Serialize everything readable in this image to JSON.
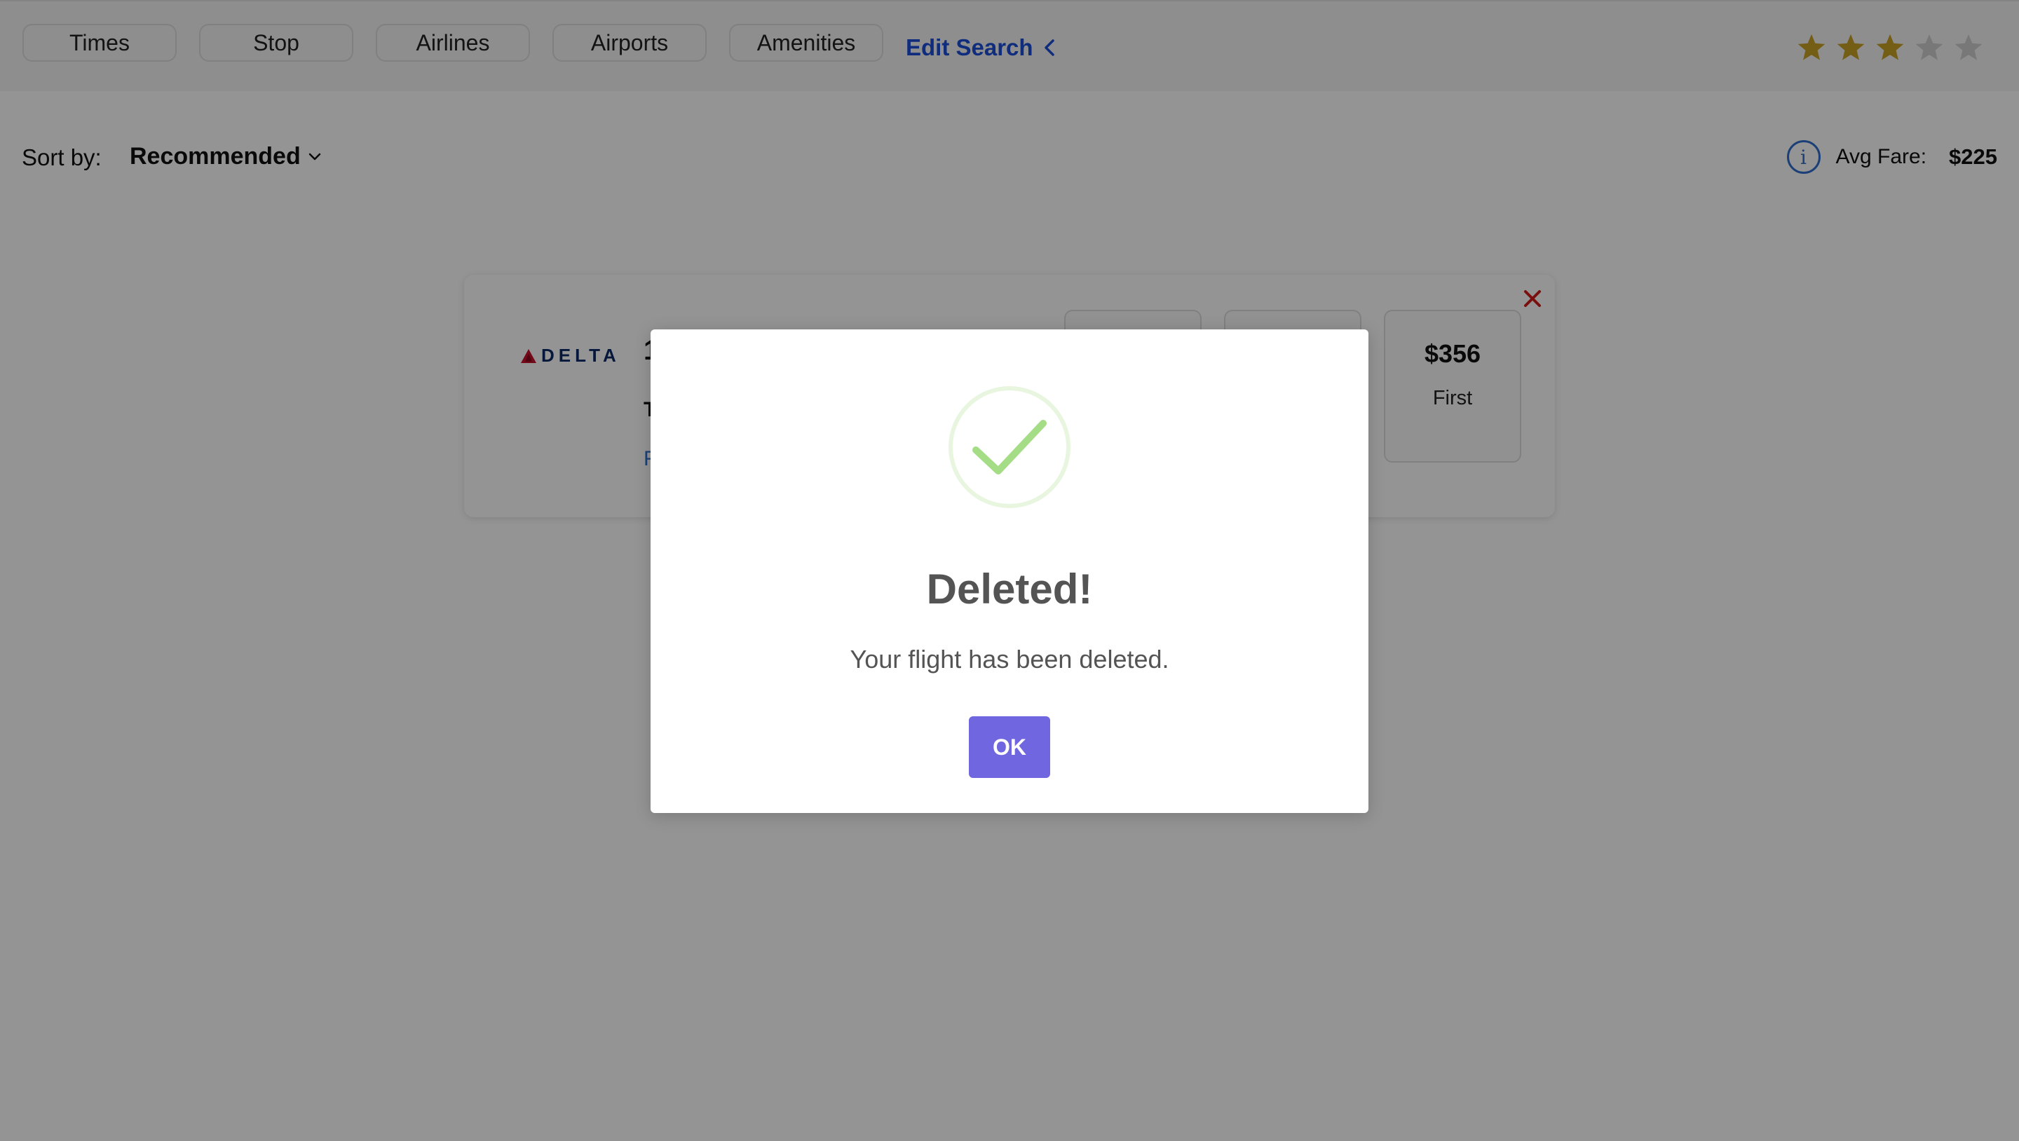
{
  "filters": {
    "times": "Times",
    "stop": "Stop",
    "airlines": "Airlines",
    "airports": "Airports",
    "amenities": "Amenities"
  },
  "edit_search": "Edit Search",
  "rating": {
    "filled": 3,
    "total": 5,
    "filled_color": "#c9a227",
    "empty_color": "#cfcfcf"
  },
  "sort": {
    "label": "Sort by:",
    "value": "Recommended"
  },
  "avg_fare": {
    "label": "Avg Fare:",
    "value": "$225"
  },
  "flight_card": {
    "airline_logo": "DELTA",
    "partial_number": "1",
    "partial_time": "T",
    "partial_link": "F",
    "fare_price": "$356",
    "fare_class": "First"
  },
  "modal": {
    "title": "Deleted!",
    "message": "Your flight has been deleted.",
    "ok_label": "OK",
    "icon": "success-check-icon",
    "button_color": "#7066e0",
    "check_color": "#a5dc86"
  }
}
